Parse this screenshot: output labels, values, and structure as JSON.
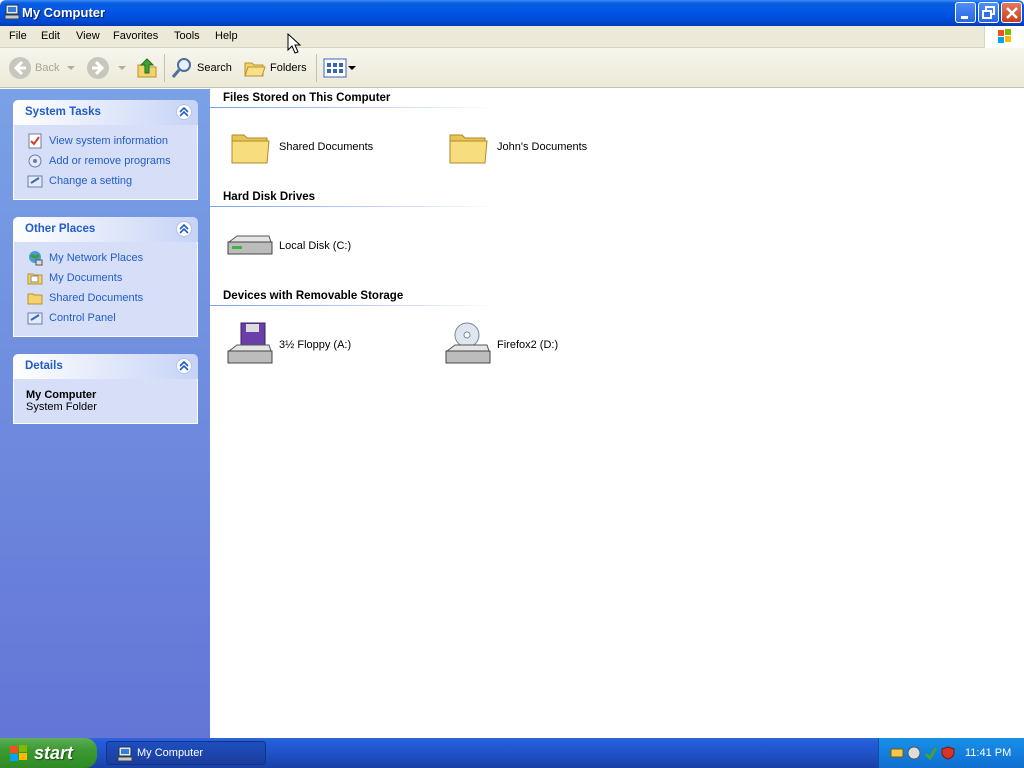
{
  "window": {
    "title": "My Computer"
  },
  "menu": [
    "File",
    "Edit",
    "View",
    "Favorites",
    "Tools",
    "Help"
  ],
  "toolbar": {
    "back": "Back",
    "search": "Search",
    "folders": "Folders"
  },
  "left_panels": {
    "system_tasks": {
      "title": "System Tasks",
      "links": [
        "View system information",
        "Add or remove programs",
        "Change a setting"
      ]
    },
    "other_places": {
      "title": "Other Places",
      "links": [
        "My Network Places",
        "My Documents",
        "Shared Documents",
        "Control Panel"
      ]
    },
    "details": {
      "title": "Details",
      "name": "My Computer",
      "type": "System Folder"
    }
  },
  "groups": {
    "files": {
      "title": "Files Stored on This Computer",
      "items": [
        "Shared Documents",
        "John's Documents"
      ]
    },
    "hdd": {
      "title": "Hard Disk Drives",
      "items": [
        "Local Disk (C:)"
      ]
    },
    "removable": {
      "title": "Devices with Removable Storage",
      "items": [
        "3½ Floppy (A:)",
        "Firefox2 (D:)"
      ]
    }
  },
  "taskbar": {
    "start": "start",
    "task": "My Computer",
    "clock": "11:41 PM"
  },
  "colors": {
    "title_bar": "#0054e3",
    "link": "#215dc6",
    "taskbar": "#245edb",
    "start": "#3c9a32"
  }
}
